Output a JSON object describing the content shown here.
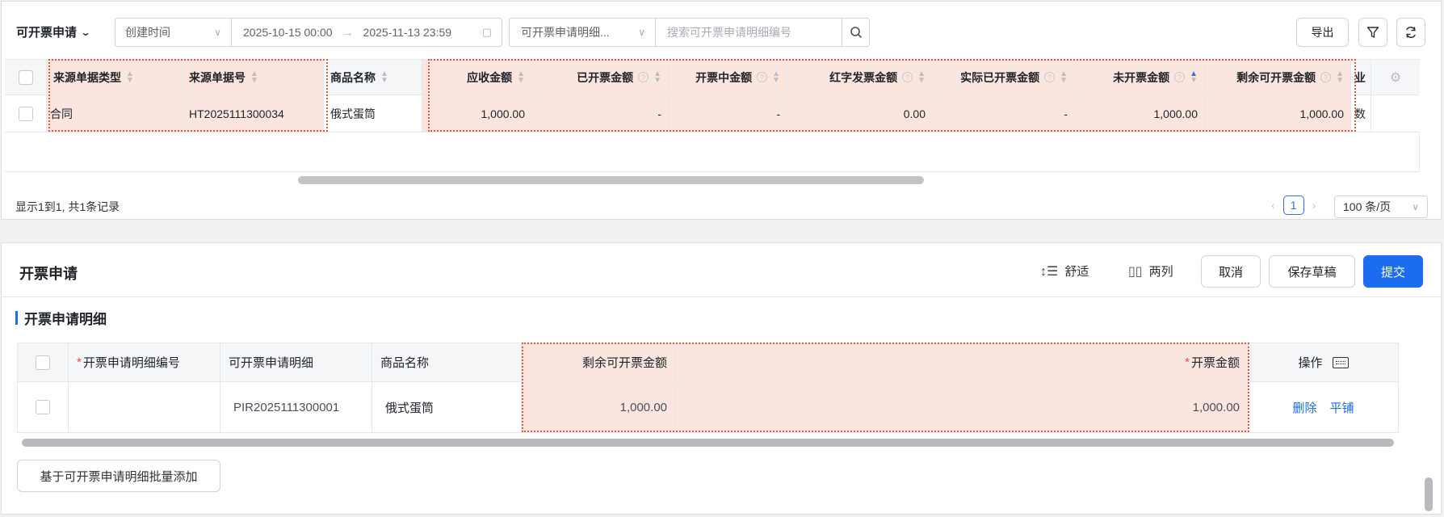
{
  "top": {
    "view_title": "可开票申请",
    "filter": {
      "date_type": "创建时间",
      "date_start": "2025-10-15 00:00",
      "date_end": "2025-11-13 23:59",
      "search_field": "可开票申请明细...",
      "search_placeholder": "搜索可开票申请明细编号"
    },
    "export_label": "导出",
    "columns": [
      "来源单据类型",
      "来源单据号",
      "商品名称",
      "应收金额",
      "已开票金额",
      "开票中金额",
      "红字发票金额",
      "实际已开票金额",
      "未开票金额",
      "剩余可开票金额",
      "业"
    ],
    "row": [
      "合同",
      "HT2025111300034",
      "俄式蛋筒",
      "1,000.00",
      "-",
      "-",
      "0.00",
      "-",
      "1,000.00",
      "1,000.00",
      "数"
    ],
    "footer_text": "显示1到1, 共1条记录",
    "current_page": "1",
    "page_size": "100 条/页"
  },
  "form": {
    "title": "开票申请",
    "toggle_comfort": "舒适",
    "toggle_two_col": "两列",
    "cancel_label": "取消",
    "save_draft_label": "保存草稿",
    "submit_label": "提交",
    "section_title": "开票申请明细",
    "columns": [
      "开票申请明细编号",
      "可开票申请明细",
      "商品名称",
      "剩余可开票金额",
      "开票金额",
      "操作"
    ],
    "row": {
      "detail_no": "",
      "invoice_detail": "PIR2025111300001",
      "product": "俄式蛋筒",
      "remaining": "1,000.00",
      "amount": "1,000.00",
      "action_delete": "删除",
      "action_tile": "平铺"
    },
    "batch_add_label": "基于可开票申请明细批量添加"
  }
}
